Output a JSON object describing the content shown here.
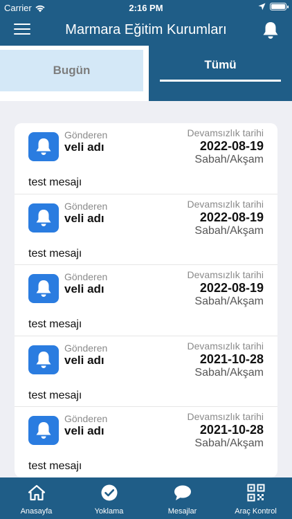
{
  "status_bar": {
    "carrier": "Carrier",
    "time": "2:16 PM"
  },
  "header": {
    "title": "Marmara Eğitim Kurumları"
  },
  "tabs": [
    {
      "label": "Bugün",
      "active": false
    },
    {
      "label": "Tümü",
      "active": true
    }
  ],
  "messages": [
    {
      "sender_label": "Gönderen",
      "sender": "veli adı",
      "date_label": "Devamsızlık tarihi",
      "date": "2022-08-19",
      "shift": "Sabah/Akşam",
      "message": "test mesajı"
    },
    {
      "sender_label": "Gönderen",
      "sender": "veli adı",
      "date_label": "Devamsızlık tarihi",
      "date": "2022-08-19",
      "shift": "Sabah/Akşam",
      "message": "test mesajı"
    },
    {
      "sender_label": "Gönderen",
      "sender": "veli adı",
      "date_label": "Devamsızlık tarihi",
      "date": "2022-08-19",
      "shift": "Sabah/Akşam",
      "message": "test mesajı"
    },
    {
      "sender_label": "Gönderen",
      "sender": "veli adı",
      "date_label": "Devamsızlık tarihi",
      "date": "2021-10-28",
      "shift": "Sabah/Akşam",
      "message": "test mesajı"
    },
    {
      "sender_label": "Gönderen",
      "sender": "veli adı",
      "date_label": "Devamsızlık tarihi",
      "date": "2021-10-28",
      "shift": "Sabah/Akşam",
      "message": "test mesajı"
    }
  ],
  "bottom_nav": [
    {
      "label": "Anasayfa",
      "icon": "home-icon"
    },
    {
      "label": "Yoklama",
      "icon": "check-circle-icon"
    },
    {
      "label": "Mesajlar",
      "icon": "chat-bubble-icon"
    },
    {
      "label": "Araç Kontrol",
      "icon": "qr-code-icon"
    }
  ],
  "colors": {
    "primary": "#1f5d87",
    "tab_inactive_bg": "#d4e8f7",
    "icon_blue": "#2a7ce0",
    "background": "#eeeff4"
  }
}
